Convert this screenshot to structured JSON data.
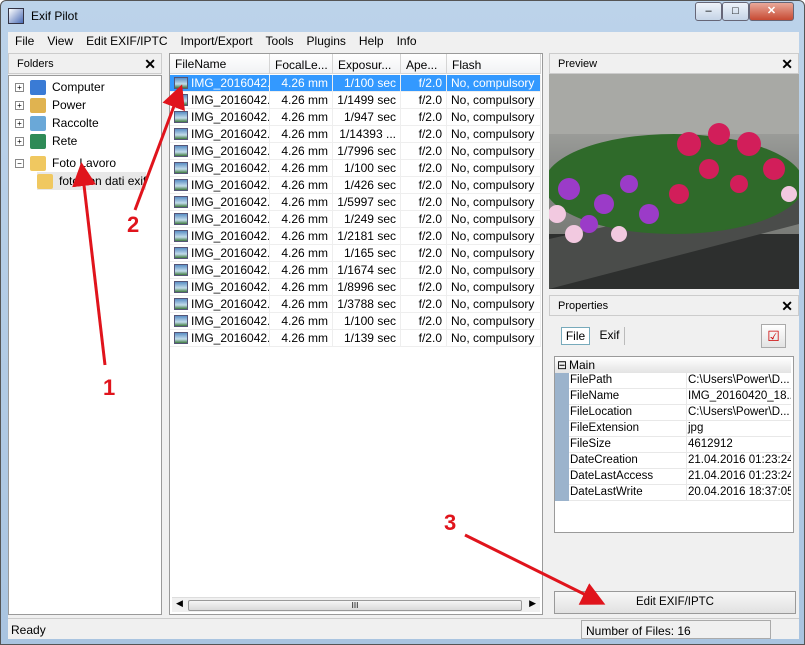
{
  "window": {
    "title": "Exif Pilot",
    "min": "–",
    "max": "□",
    "close": "✕"
  },
  "menu": [
    "File",
    "View",
    "Edit EXIF/IPTC",
    "Import/Export",
    "Tools",
    "Plugins",
    "Help",
    "Info"
  ],
  "folders": {
    "title": "Folders",
    "close": "✕",
    "items": [
      {
        "label": "Computer",
        "expander": "+",
        "color": "#3a7bd5"
      },
      {
        "label": "Power",
        "expander": "+",
        "color": "#e0b350"
      },
      {
        "label": "Raccolte",
        "expander": "+",
        "color": "#6aa8d8"
      },
      {
        "label": "Rete",
        "expander": "+",
        "color": "#2e8b57"
      },
      {
        "label": "Foto Lavoro",
        "expander": "−",
        "color": "#f0c860"
      },
      {
        "label": "foto con dati exif",
        "expander": "",
        "color": "#f0c860"
      }
    ]
  },
  "files": {
    "columns": [
      "FileName",
      "FocalLe...",
      "Exposur...",
      "Ape...",
      "Flash"
    ],
    "rows": [
      [
        "IMG_2016042...",
        "4.26 mm",
        "1/100 sec",
        "f/2.0",
        "No, compulsory"
      ],
      [
        "IMG_2016042...",
        "4.26 mm",
        "1/1499 sec",
        "f/2.0",
        "No, compulsory"
      ],
      [
        "IMG_2016042...",
        "4.26 mm",
        "1/947 sec",
        "f/2.0",
        "No, compulsory"
      ],
      [
        "IMG_2016042...",
        "4.26 mm",
        "1/14393 ...",
        "f/2.0",
        "No, compulsory"
      ],
      [
        "IMG_2016042...",
        "4.26 mm",
        "1/7996 sec",
        "f/2.0",
        "No, compulsory"
      ],
      [
        "IMG_2016042...",
        "4.26 mm",
        "1/100 sec",
        "f/2.0",
        "No, compulsory"
      ],
      [
        "IMG_2016042...",
        "4.26 mm",
        "1/426 sec",
        "f/2.0",
        "No, compulsory"
      ],
      [
        "IMG_2016042...",
        "4.26 mm",
        "1/5997 sec",
        "f/2.0",
        "No, compulsory"
      ],
      [
        "IMG_2016042...",
        "4.26 mm",
        "1/249 sec",
        "f/2.0",
        "No, compulsory"
      ],
      [
        "IMG_2016042...",
        "4.26 mm",
        "1/2181 sec",
        "f/2.0",
        "No, compulsory"
      ],
      [
        "IMG_2016042...",
        "4.26 mm",
        "1/165 sec",
        "f/2.0",
        "No, compulsory"
      ],
      [
        "IMG_2016042...",
        "4.26 mm",
        "1/1674 sec",
        "f/2.0",
        "No, compulsory"
      ],
      [
        "IMG_2016042...",
        "4.26 mm",
        "1/8996 sec",
        "f/2.0",
        "No, compulsory"
      ],
      [
        "IMG_2016042...",
        "4.26 mm",
        "1/3788 sec",
        "f/2.0",
        "No, compulsory"
      ],
      [
        "IMG_2016042...",
        "4.26 mm",
        "1/100 sec",
        "f/2.0",
        "No, compulsory"
      ],
      [
        "IMG_2016042...",
        "4.26 mm",
        "1/139 sec",
        "f/2.0",
        "No, compulsory"
      ]
    ],
    "selected_index": 0,
    "scroll_grip": "III"
  },
  "preview": {
    "title": "Preview",
    "close": "✕"
  },
  "properties": {
    "title": "Properties",
    "close": "✕",
    "tabs": [
      "File",
      "Exif"
    ],
    "active_tab": "File",
    "group": "Main",
    "group_toggle": "⊟",
    "rows": [
      [
        "FilePath",
        "C:\\Users\\Power\\D..."
      ],
      [
        "FileName",
        "IMG_20160420_18..."
      ],
      [
        "FileLocation",
        "C:\\Users\\Power\\D..."
      ],
      [
        "FileExtension",
        "jpg"
      ],
      [
        "FileSize",
        "4612912"
      ],
      [
        "DateCreation",
        "21.04.2016 01:23:24"
      ],
      [
        "DateLastAccess",
        "21.04.2016 01:23:24"
      ],
      [
        "DateLastWrite",
        "20.04.2016 18:37:05"
      ]
    ],
    "edit_button": "Edit EXIF/IPTC"
  },
  "status": {
    "left": "Ready",
    "right": "Number of Files: 16"
  },
  "annotations": {
    "labels": [
      "1",
      "2",
      "3"
    ],
    "color": "#e0141c"
  }
}
